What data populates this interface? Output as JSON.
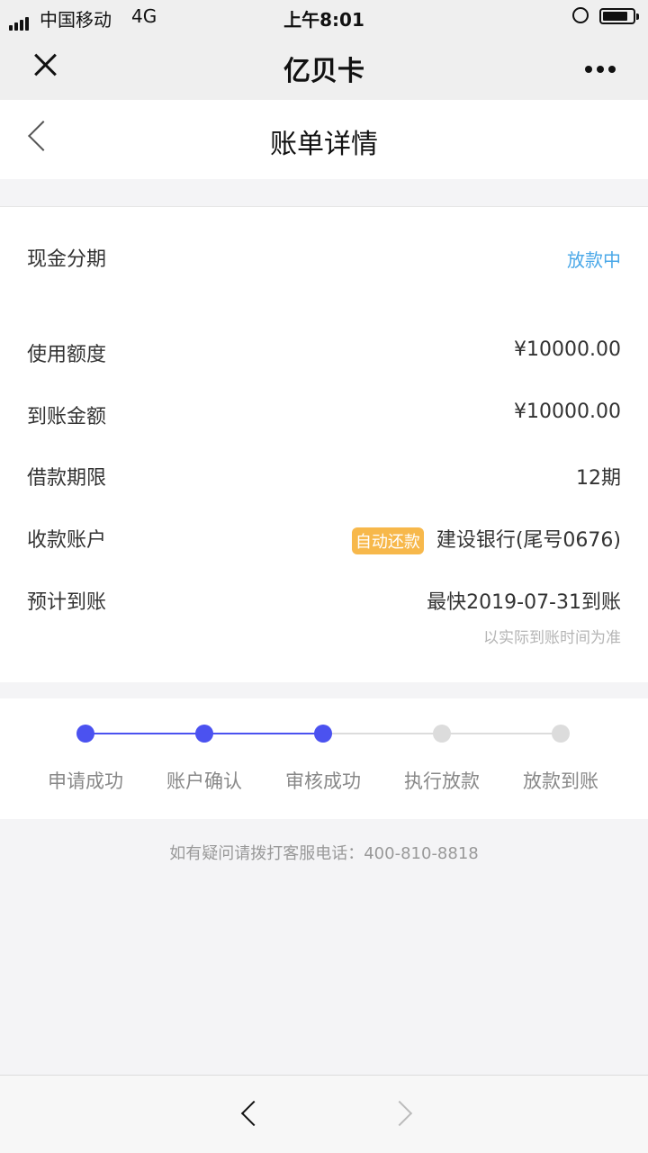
{
  "status_bar": {
    "carrier": "中国移动",
    "network": "4G",
    "time": "上午8:01"
  },
  "wechat_bar": {
    "title": "亿贝卡"
  },
  "page": {
    "title": "账单详情"
  },
  "summary": {
    "type_label": "现金分期",
    "status": "放款中"
  },
  "details": {
    "usage_label": "使用额度",
    "usage_value": "¥10000.00",
    "received_label": "到账金额",
    "received_value": "¥10000.00",
    "term_label": "借款期限",
    "term_value": "12期",
    "account_label": "收款账户",
    "account_badge": "自动还款",
    "account_value": "建设银行(尾号0676)",
    "eta_label": "预计到账",
    "eta_value": "最快2019-07-31到账",
    "eta_note": "以实际到账时间为准"
  },
  "progress": {
    "completed_steps": 3,
    "steps": [
      "申请成功",
      "账户确认",
      "审核成功",
      "执行放款",
      "放款到账"
    ],
    "active_color": "#4b52f0",
    "inactive_color": "#dcdcdc"
  },
  "help_text": "如有疑问请拨打客服电话：400-810-8818"
}
